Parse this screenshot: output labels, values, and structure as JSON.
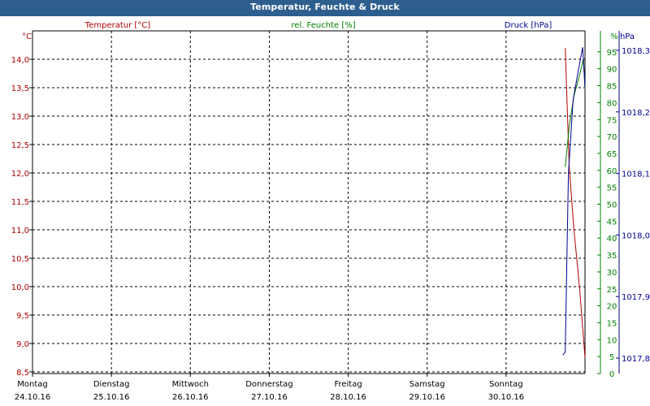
{
  "window": {
    "title": "Temperatur, Feuchte & Druck"
  },
  "colors": {
    "temperature": "#b00000",
    "humidity": "#008000",
    "pressure": "#000090",
    "grid": "#000000",
    "titlebar": "#2d5e8e"
  },
  "chart_data": {
    "type": "line",
    "title": "Temperatur, Feuchte & Druck",
    "legend_placement": "top",
    "grid": true,
    "x_axis": {
      "categories": [
        {
          "day": "Montag",
          "date": "24.10.16"
        },
        {
          "day": "Dienstag",
          "date": "25.10.16"
        },
        {
          "day": "Mittwoch",
          "date": "26.10.16"
        },
        {
          "day": "Donnerstag",
          "date": "27.10.16"
        },
        {
          "day": "Freitag",
          "date": "28.10.16"
        },
        {
          "day": "Samstag",
          "date": "29.10.16"
        },
        {
          "day": "Sonntag",
          "date": "30.10.16"
        }
      ],
      "range_days": [
        0,
        7
      ]
    },
    "axes": {
      "temperature": {
        "label": "Temperatur [°C]",
        "unit": "°C",
        "range": [
          8.5,
          14.5
        ],
        "ticks": [
          "14,0",
          "13,5",
          "13,0",
          "12,5",
          "12,0",
          "11,5",
          "11,0",
          "10,5",
          "10,0",
          "9,5",
          "9,0",
          "8,5"
        ],
        "tick_values": [
          14.0,
          13.5,
          13.0,
          12.5,
          12.0,
          11.5,
          11.0,
          10.5,
          10.0,
          9.5,
          9.0,
          8.5
        ]
      },
      "humidity": {
        "label": "rel. Feuchte [%]",
        "unit": "%",
        "range": [
          0,
          100
        ],
        "ticks": [
          "95",
          "90",
          "85",
          "80",
          "75",
          "70",
          "65",
          "60",
          "55",
          "50",
          "45",
          "40",
          "35",
          "30",
          "25",
          "20",
          "15",
          "10",
          "5",
          "0"
        ],
        "tick_values": [
          95,
          90,
          85,
          80,
          75,
          70,
          65,
          60,
          55,
          50,
          45,
          40,
          35,
          30,
          25,
          20,
          15,
          10,
          5,
          0
        ]
      },
      "pressure": {
        "label": "Druck [hPa]",
        "unit": "hPa",
        "range": [
          1017.78,
          1018.34
        ],
        "ticks": [
          "1018,3",
          "1018,2",
          "1018,1",
          "1018,0",
          "1017,9",
          "1017,8"
        ],
        "tick_values": [
          1018.3,
          1018.2,
          1018.1,
          1018.0,
          1017.9,
          1017.8
        ]
      }
    },
    "series": [
      {
        "axis": "temperature",
        "x_days": [
          6.75,
          6.8,
          6.86,
          6.93,
          7.0
        ],
        "values": [
          14.2,
          12.1,
          11.0,
          10.0,
          8.75
        ]
      },
      {
        "axis": "humidity",
        "x_days": [
          6.75,
          6.8,
          6.86,
          6.93,
          6.98,
          7.0
        ],
        "values": [
          61,
          73,
          82,
          88,
          93,
          84
        ]
      },
      {
        "axis": "pressure",
        "x_days": [
          6.72,
          6.75,
          6.79,
          6.85,
          6.92,
          6.97,
          7.0
        ],
        "values": [
          1017.805,
          1017.81,
          1018.1,
          1018.22,
          1018.27,
          1018.305,
          1018.24
        ]
      }
    ]
  }
}
